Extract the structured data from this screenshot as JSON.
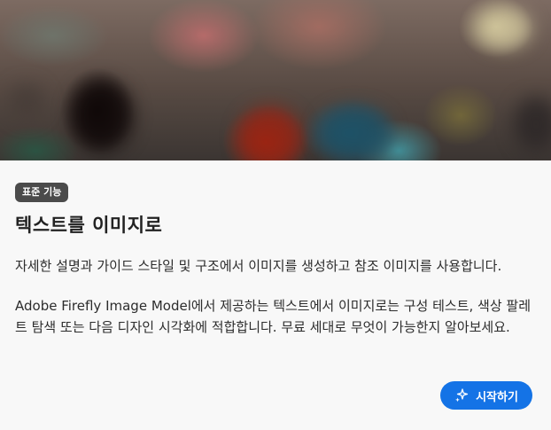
{
  "hero": {
    "icon": "abstract-blurred-image"
  },
  "badge": {
    "label": "표준 기능"
  },
  "title": "텍스트를 이미지로",
  "description": {
    "line1": "자세한 설명과 가이드 스타일 및 구조에서 이미지를 생성하고 참조 이미지를 사용합니다.",
    "line2": "Adobe Firefly Image Model에서 제공하는 텍스트에서 이미지로는 구성 테스트, 색상 팔레트 탐색 또는 다음 디자인 시각화에 적합합니다. 무료 세대로 무엇이 가능한지 알아보세요."
  },
  "start_button": {
    "label": "시작하기",
    "icon": "sparkle-icon"
  },
  "colors": {
    "accent": "#1473e6",
    "badge_bg": "#4b4b4b",
    "background": "#f8f8f8"
  }
}
